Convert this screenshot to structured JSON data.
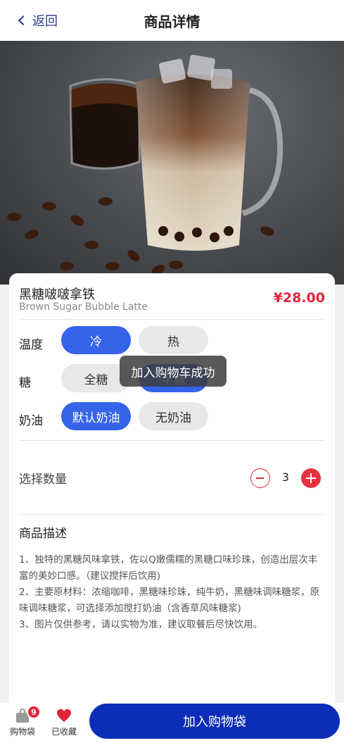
{
  "nav": {
    "back_label": "返回",
    "title": "商品详情"
  },
  "product": {
    "name_cn": "黑糖啵啵拿铁",
    "name_en": "Brown Sugar Bubble Latte",
    "price": "¥28.00"
  },
  "options": {
    "temperature": {
      "label": "温度",
      "choices": [
        "冷",
        "热"
      ],
      "selected": "冷"
    },
    "sugar": {
      "label": "糖",
      "choices": [
        "全糖",
        "半糖"
      ],
      "selected": "半糖"
    },
    "cream": {
      "label": "奶油",
      "choices": [
        "默认奶油",
        "无奶油"
      ],
      "selected": "默认奶油"
    }
  },
  "toast": {
    "text": "加入购物车成功"
  },
  "quantity": {
    "label": "选择数量",
    "value": "3"
  },
  "description": {
    "title": "商品描述",
    "lines": [
      "1、独特的黑糖风味拿铁，佐以Q嫩儒糯的黑糖口味珍珠，创造出层次丰富的美妙口感。（建议搅拌后饮用)",
      "2、主要原材料：浓缩咖啡，黑糖味珍珠，纯牛奶，黑糖味调味糖浆，原味调味糖浆，可选择添加搅打奶油（含香草风味糖浆)",
      "3、图片仅供参考，请以实物为准，建议取餐后尽快饮用。"
    ]
  },
  "bottom_bar": {
    "bag_label": "购物袋",
    "bag_count": "9",
    "favorite_label": "已收藏",
    "add_to_bag_label": "加入购物袋"
  },
  "colors": {
    "accent_blue": "#3563e9",
    "cta_blue": "#0c2db8",
    "price_red": "#e1263a"
  },
  "icons": {
    "back": "chevron-left-icon",
    "bag": "shopping-bag-icon",
    "favorite": "heart-icon",
    "minus": "minus-circle-icon",
    "plus": "plus-circle-icon"
  }
}
